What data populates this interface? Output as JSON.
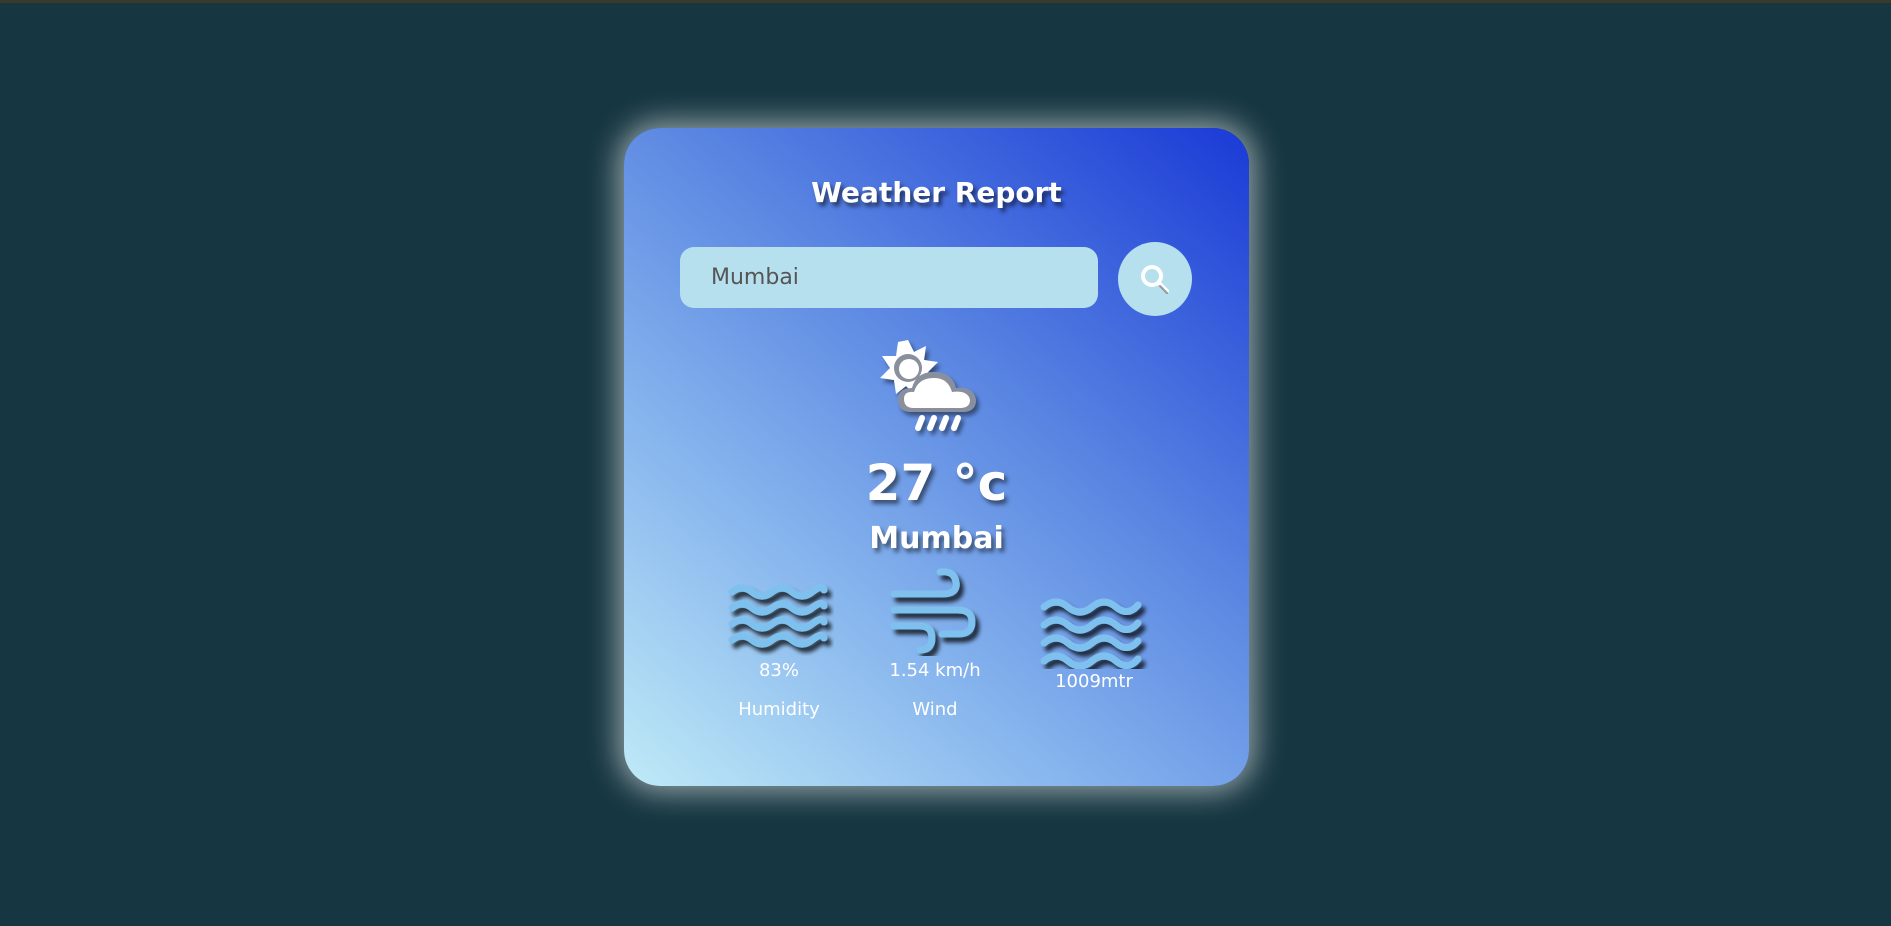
{
  "title": "Weather Report",
  "search": {
    "value": "Mumbai",
    "icon": "search-icon"
  },
  "weather": {
    "icon": "sun-cloud-rain-icon",
    "temperature": "27 °c",
    "city": "Mumbai"
  },
  "details": {
    "humidity": {
      "icon": "humidity-waves-icon",
      "value": "83%",
      "label": "Humidity"
    },
    "wind": {
      "icon": "wind-icon",
      "value": "1.54 km/h",
      "label": "Wind"
    },
    "pressure": {
      "icon": "pressure-waves-icon",
      "value": "1009mtr"
    }
  },
  "colors": {
    "background": "#163641",
    "card_gradient_start": "#1a3ad6",
    "card_gradient_end": "#bfeaf7",
    "input_bg": "#b6e0ee",
    "detail_icon": "#7ec0ee"
  }
}
